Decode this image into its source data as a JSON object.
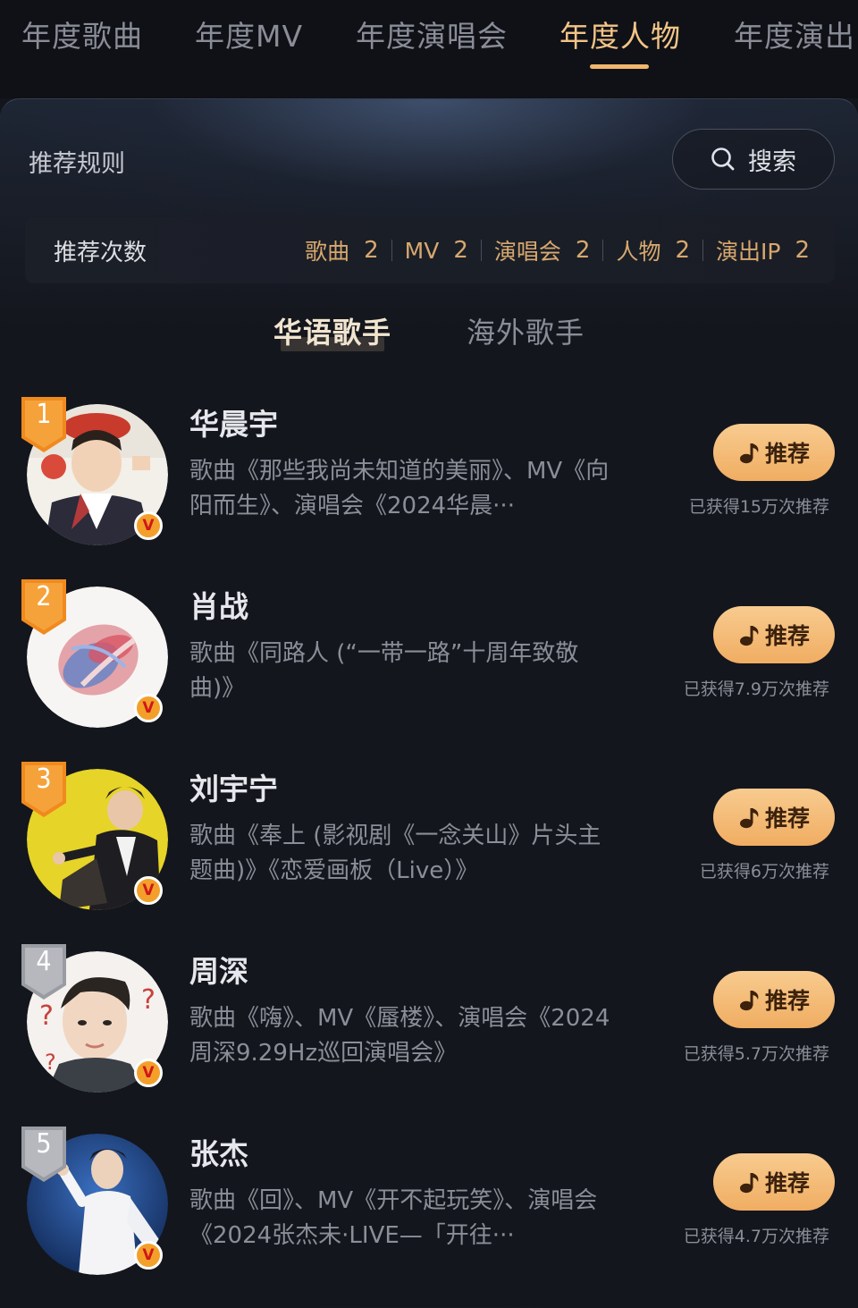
{
  "top_tabs": [
    {
      "label": "年度歌曲",
      "active": false
    },
    {
      "label": "年度MV",
      "active": false
    },
    {
      "label": "年度演唱会",
      "active": false
    },
    {
      "label": "年度人物",
      "active": true
    },
    {
      "label": "年度演出",
      "active": false
    }
  ],
  "panel": {
    "rules_title": "推荐规则",
    "search_label": "搜索",
    "count_title": "推荐次数",
    "count_items": [
      {
        "label": "歌曲",
        "value": "2"
      },
      {
        "label": "MV",
        "value": "2"
      },
      {
        "label": "演唱会",
        "value": "2"
      },
      {
        "label": "人物",
        "value": "2"
      },
      {
        "label": "演出IP",
        "value": "2"
      }
    ]
  },
  "sub_tabs": [
    {
      "label": "华语歌手",
      "active": true
    },
    {
      "label": "海外歌手",
      "active": false
    }
  ],
  "colors": {
    "accent": "#f3c487",
    "button_gradient_top": "#f8cb8f",
    "button_gradient_bottom": "#f0ad62",
    "rank_gold": "#f08a1e",
    "rank_silver": "#9a9ca3",
    "v_badge": "#f3a02b"
  },
  "artists": [
    {
      "rank": "1",
      "name": "华晨宇",
      "desc": "歌曲《那些我尚未知道的美丽》、MV《向阳而生》、演唱会《2024华晨···",
      "button_label": "推荐",
      "rec_count": "已获得15万次推荐",
      "verified_icon": "v-icon"
    },
    {
      "rank": "2",
      "name": "肖战",
      "desc": "歌曲《同路人 (“一带一路”十周年致敬曲)》",
      "button_label": "推荐",
      "rec_count": "已获得7.9万次推荐",
      "verified_icon": "v-icon"
    },
    {
      "rank": "3",
      "name": "刘宇宁",
      "desc": "歌曲《奉上 (影视剧《一念关山》片头主题曲)》《恋爱画板（Live）》",
      "button_label": "推荐",
      "rec_count": "已获得6万次推荐",
      "verified_icon": "v-icon"
    },
    {
      "rank": "4",
      "name": "周深",
      "desc": "歌曲《嗨》、MV《蜃楼》、演唱会《2024周深9.29Hz巡回演唱会》",
      "button_label": "推荐",
      "rec_count": "已获得5.7万次推荐",
      "verified_icon": "v-icon"
    },
    {
      "rank": "5",
      "name": "张杰",
      "desc": "歌曲《回》、MV《开不起玩笑》、演唱会《2024张杰未·LIVE—「开往···",
      "button_label": "推荐",
      "rec_count": "已获得4.7万次推荐",
      "verified_icon": "v-icon"
    }
  ]
}
